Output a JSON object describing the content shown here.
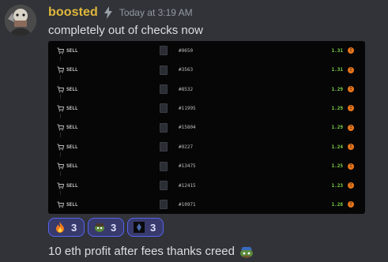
{
  "message": {
    "username": "boosted",
    "timestamp": "Today at 3:19 AM",
    "content_1": "completely out of checks now",
    "content_2": "10 eth profit after fees thanks creed",
    "colors": {
      "username": "#e0b83a",
      "background": "#313338",
      "accent": "#5865f2"
    }
  },
  "embed": {
    "rows": [
      {
        "action": "SELL",
        "token": "#9650",
        "price": "1.31"
      },
      {
        "action": "SELL",
        "token": "#3563",
        "price": "1.31"
      },
      {
        "action": "SELL",
        "token": "#8532",
        "price": "1.29"
      },
      {
        "action": "SELL",
        "token": "#11995",
        "price": "1.29"
      },
      {
        "action": "SELL",
        "token": "#15804",
        "price": "1.29"
      },
      {
        "action": "SELL",
        "token": "#9227",
        "price": "1.24"
      },
      {
        "action": "SELL",
        "token": "#13475",
        "price": "1.25"
      },
      {
        "action": "SELL",
        "token": "#12415",
        "price": "1.23"
      },
      {
        "action": "SELL",
        "token": "#10971",
        "price": "1.28"
      }
    ],
    "price_color": "#7fd84a",
    "eth_icon": "eth-coin-icon"
  },
  "reactions": [
    {
      "emoji": "fire-icon",
      "count": "3"
    },
    {
      "emoji": "pepe-custom-icon",
      "count": "3"
    },
    {
      "emoji": "nft-custom-icon",
      "count": "3"
    }
  ]
}
